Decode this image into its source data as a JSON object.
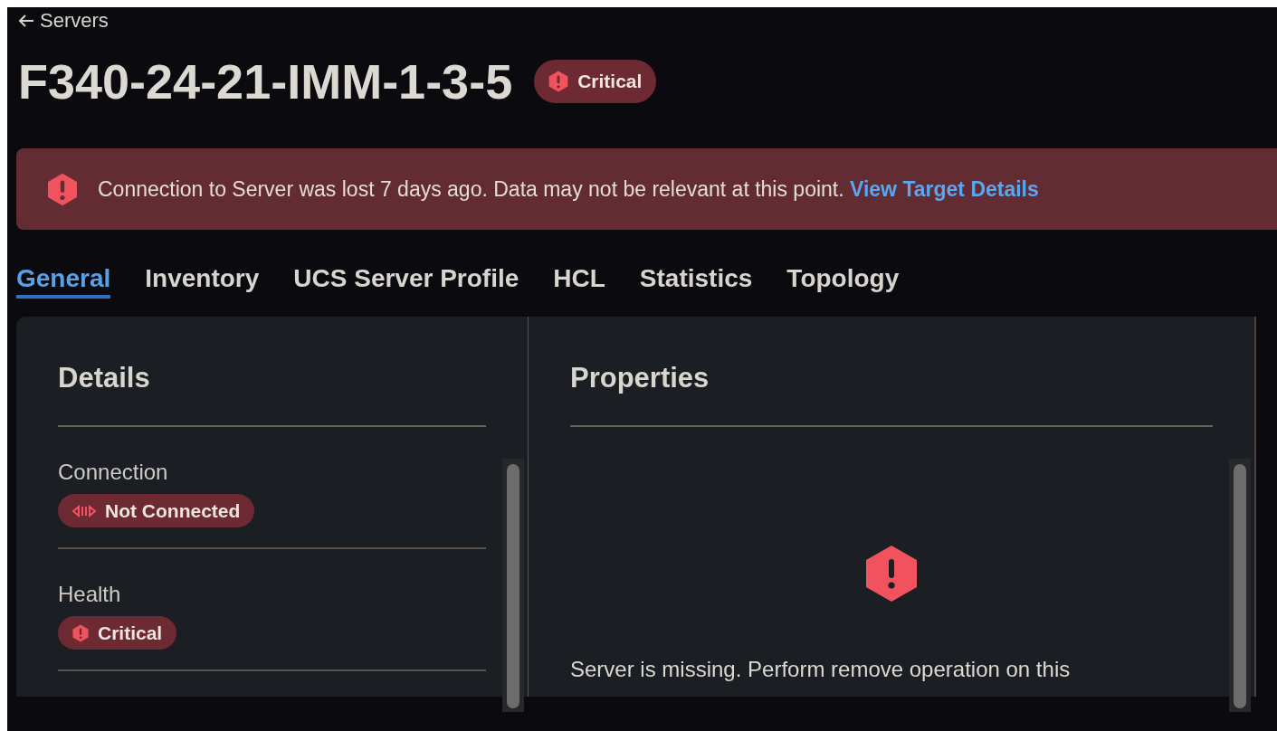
{
  "back_link": {
    "label": "Servers"
  },
  "title": "F340-24-21-IMM-1-3-5",
  "title_badge": {
    "kind": "critical",
    "label": "Critical"
  },
  "alert_banner": {
    "message": "Connection to Server was lost 7 days ago. Data may not be relevant at this point.",
    "link": "View Target Details"
  },
  "tabs": [
    {
      "label": "General",
      "selected": true
    },
    {
      "label": "Inventory",
      "selected": false
    },
    {
      "label": "UCS Server Profile",
      "selected": false
    },
    {
      "label": "HCL",
      "selected": false
    },
    {
      "label": "Statistics",
      "selected": false
    },
    {
      "label": "Topology",
      "selected": false
    }
  ],
  "details": {
    "heading": "Details",
    "fields": [
      {
        "label": "Connection",
        "badge": {
          "kind": "disconnected",
          "label": "Not Connected"
        }
      },
      {
        "label": "Health",
        "badge": {
          "kind": "critical",
          "label": "Critical"
        }
      }
    ]
  },
  "properties": {
    "heading": "Properties",
    "message": "Server is missing. Perform remove operation on this"
  }
}
